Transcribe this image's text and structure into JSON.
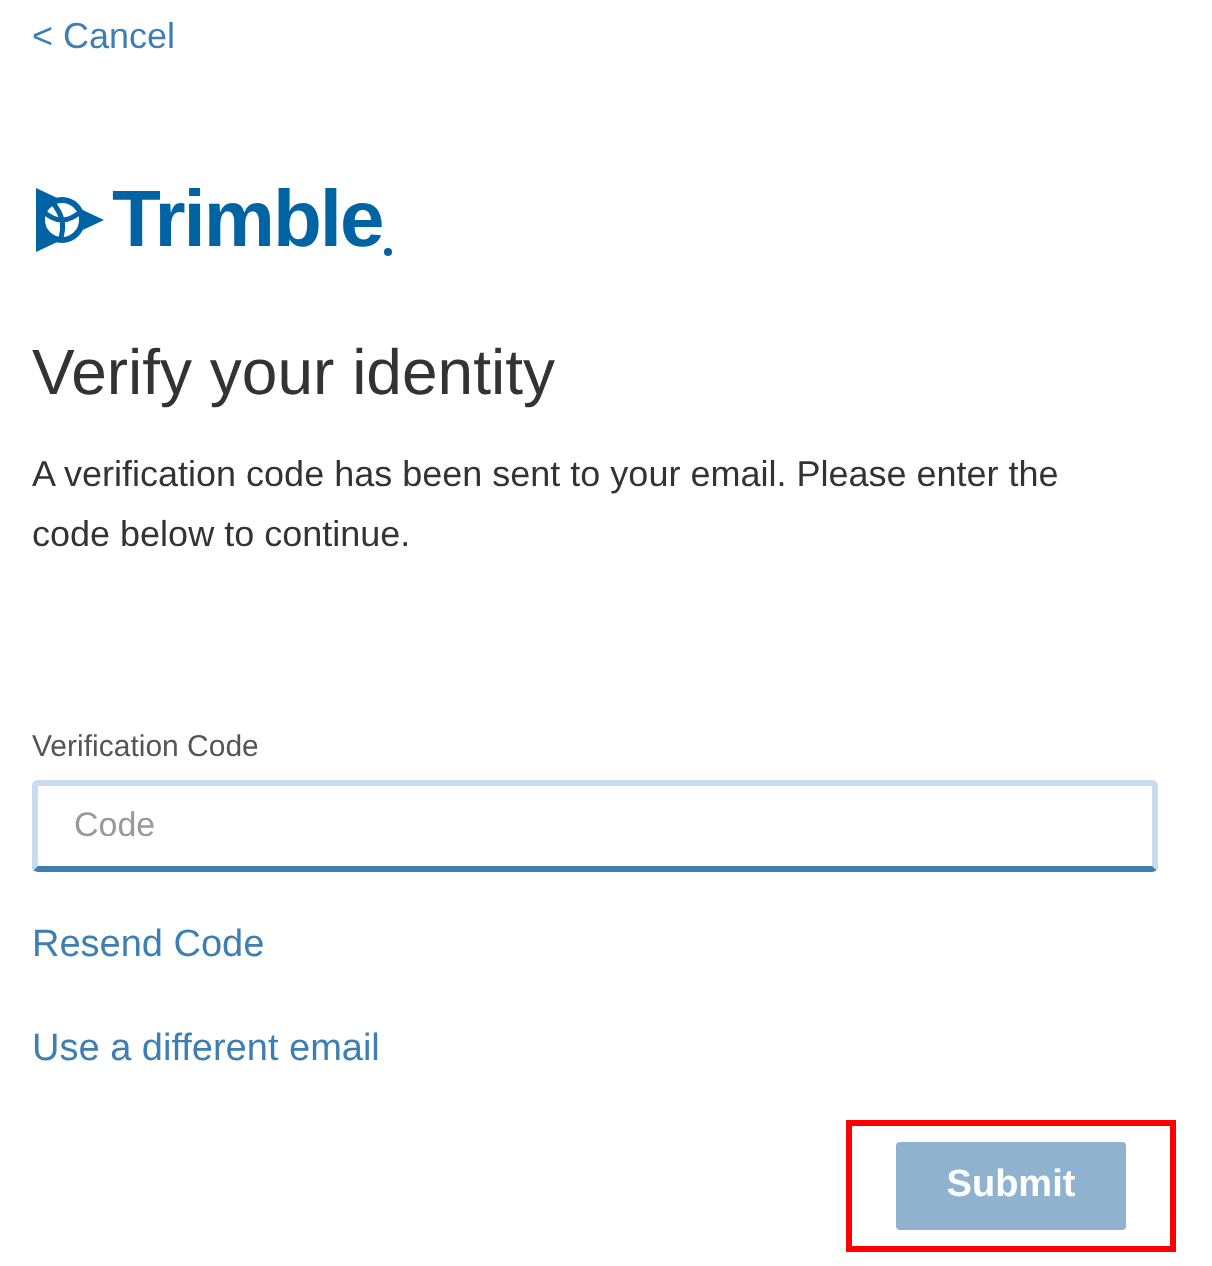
{
  "cancel_link": "< Cancel",
  "logo": {
    "wordmark": "Trimble"
  },
  "title": "Verify your identity",
  "description": "A verification code has been sent to your email. Please enter the code below to continue.",
  "code_field": {
    "label": "Verification Code",
    "placeholder": "Code",
    "focused": true
  },
  "links": [
    "Resend Code",
    "Use a different email"
  ],
  "submit_button": {
    "label": "Submit",
    "disabled": true,
    "highlighted": true
  }
}
